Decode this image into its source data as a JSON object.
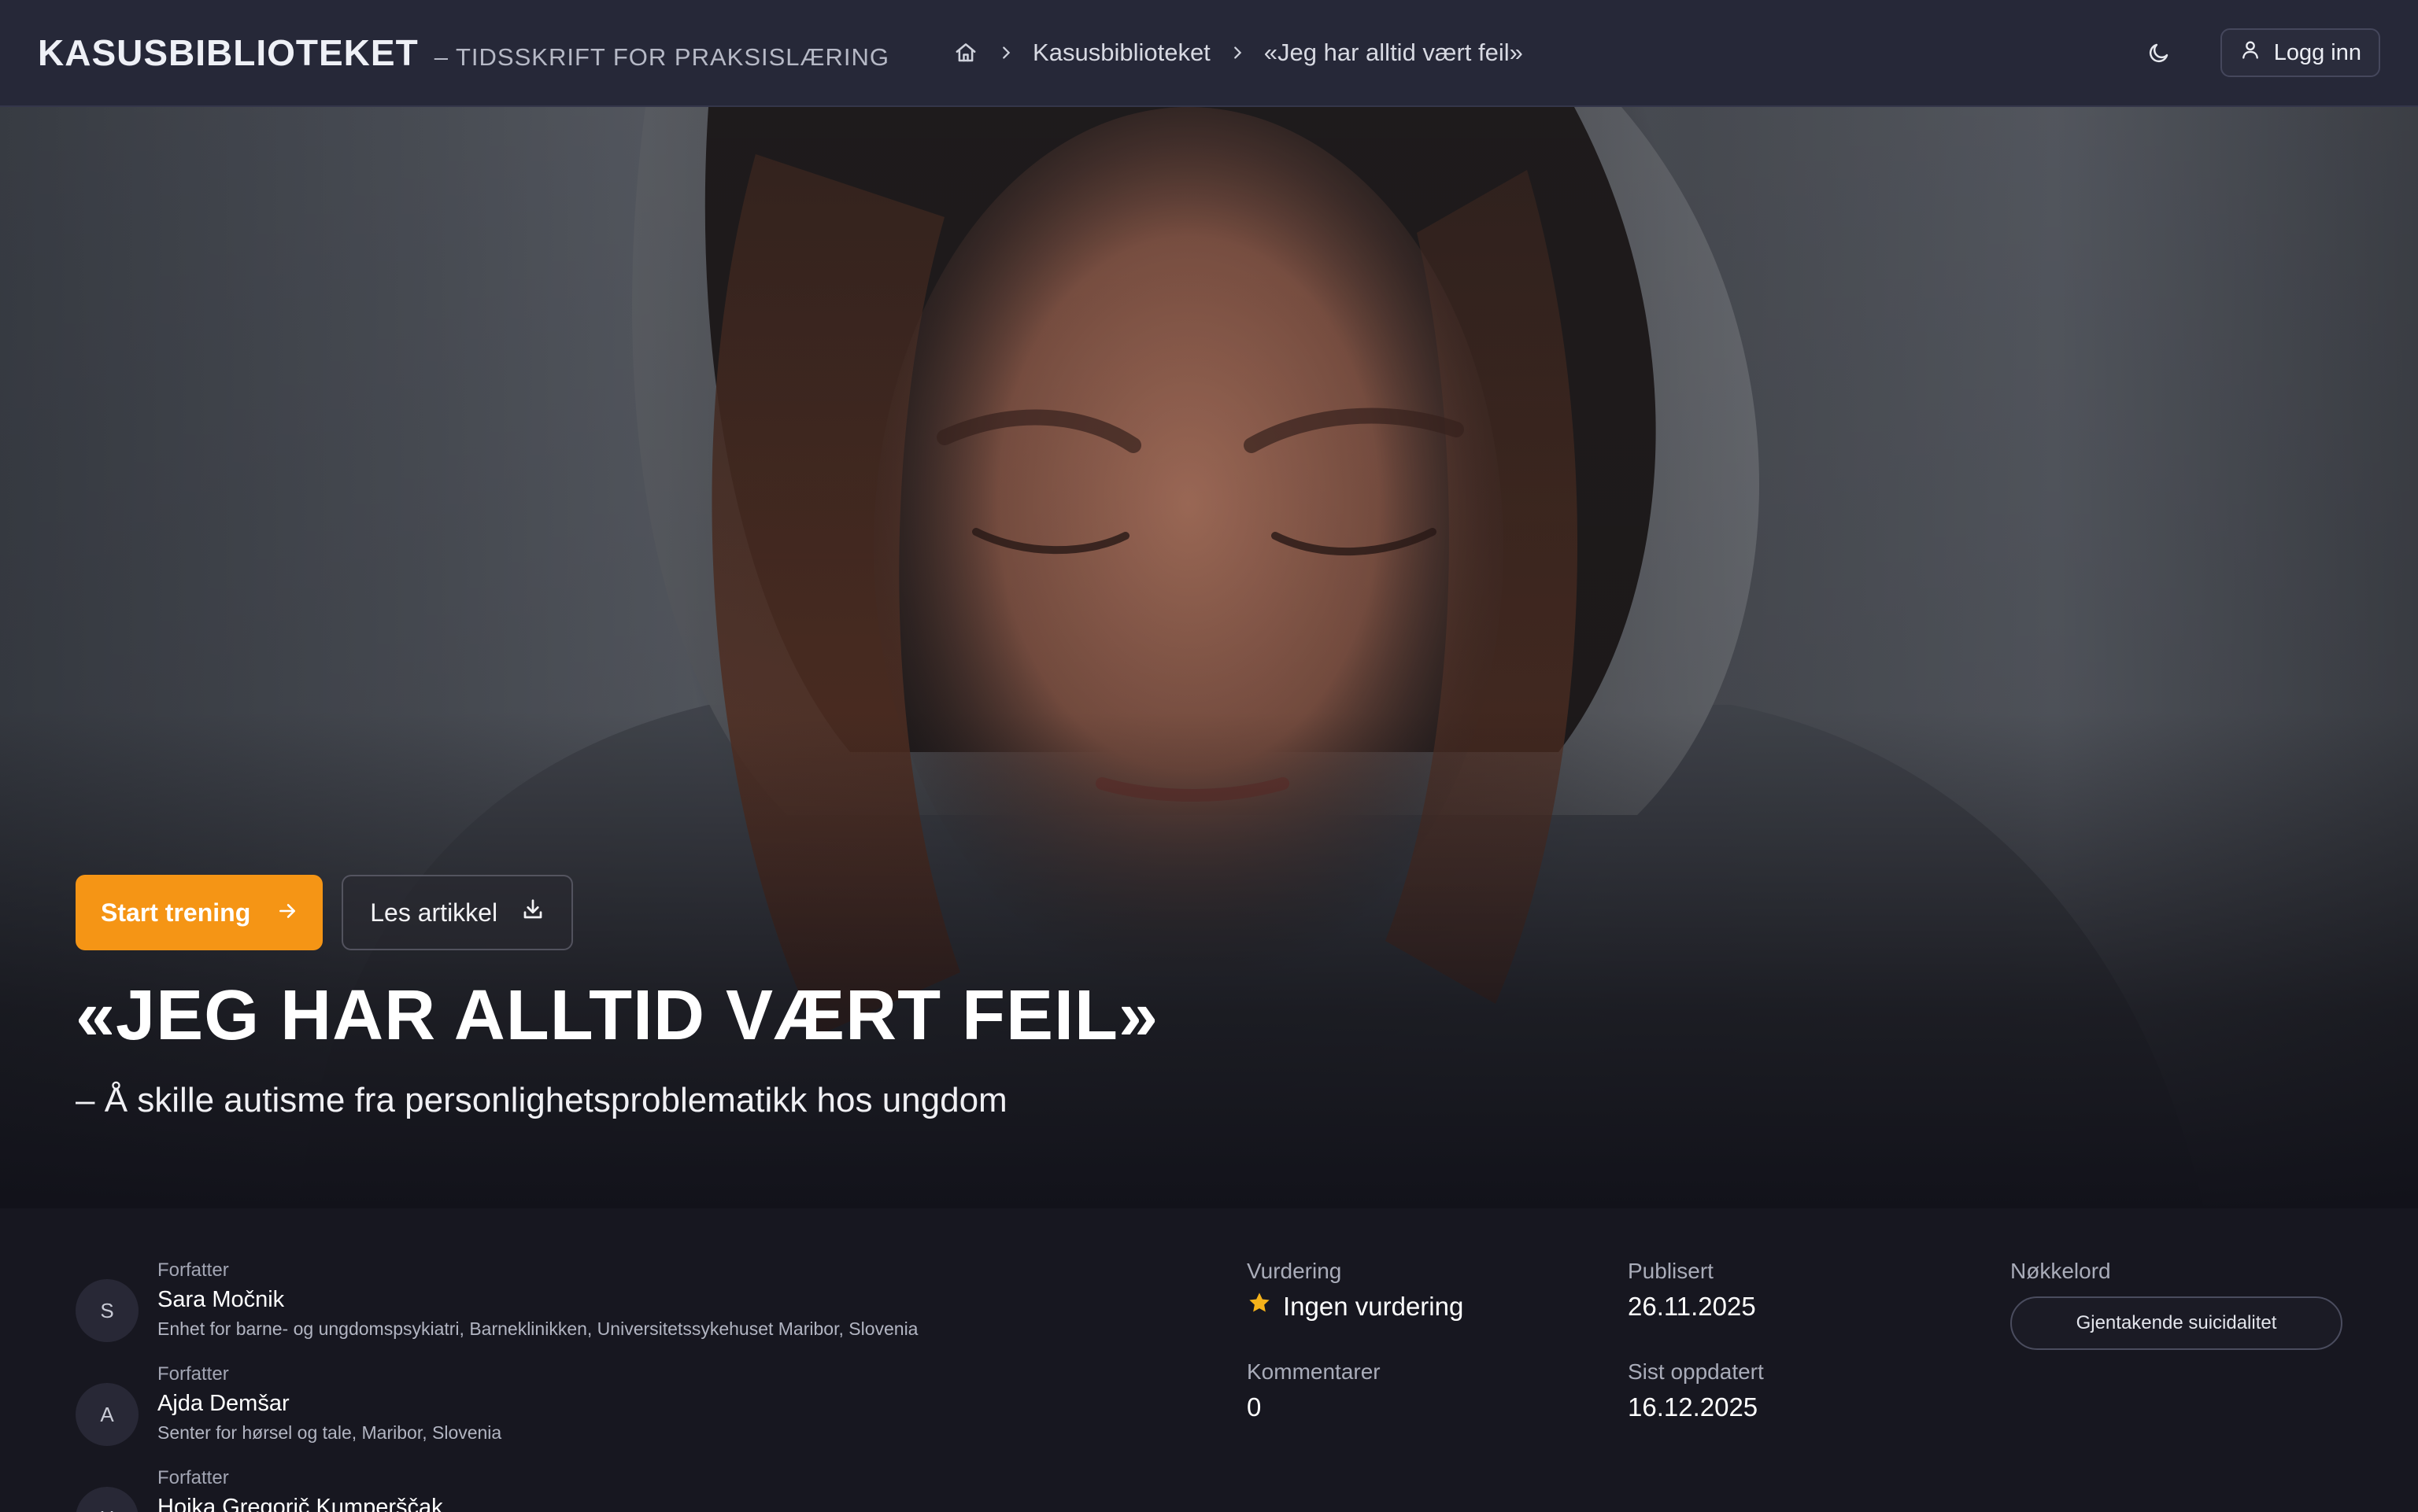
{
  "header": {
    "brand_title": "KASUSBIBLIOTEKET",
    "brand_subtitle": "– TIDSSKRIFT FOR PRAKSISLÆRING",
    "breadcrumb": {
      "home_icon": "home-icon",
      "items": [
        "Kasusbiblioteket",
        "«Jeg har alltid vært feil»"
      ]
    },
    "theme_toggle_icon": "moon-icon",
    "login": {
      "icon": "user-icon",
      "label": "Logg inn"
    }
  },
  "hero": {
    "image": "photo of young woman in grey hoodie looking down",
    "actions": {
      "start": {
        "label": "Start trening",
        "icon": "arrow-right-icon"
      },
      "read": {
        "label": "Les artikkel",
        "icon": "download-icon"
      }
    },
    "title": "«JEG HAR ALLTID VÆRT FEIL»",
    "subtitle": "– Å skille autisme fra personlighetsproblematikk hos ungdom"
  },
  "authors": [
    {
      "initial": "S",
      "role": "Forfatter",
      "name": "Sara Močnik",
      "affiliation": "Enhet for barne- og ungdomspsykiatri, Barneklinikken, Universitetssykehuset Maribor, Slovenia"
    },
    {
      "initial": "A",
      "role": "Forfatter",
      "name": "Ajda Demšar",
      "affiliation": "Senter for hørsel og tale, Maribor, Slovenia"
    },
    {
      "initial": "H",
      "role": "Forfatter",
      "name": "Hojka Gregorič Kumperščak",
      "affiliation": ""
    }
  ],
  "meta": {
    "rating": {
      "label": "Vurdering",
      "value": "Ingen vurdering",
      "icon": "star-icon"
    },
    "comments": {
      "label": "Kommentarer",
      "value": "0"
    },
    "published": {
      "label": "Publisert",
      "value": "26.11.2025"
    },
    "updated": {
      "label": "Sist oppdatert",
      "value": "16.12.2025"
    },
    "keywords": {
      "label": "Nøkkelord",
      "items": [
        "Gjentakende suicidalitet"
      ]
    }
  },
  "colors": {
    "accent": "#f59515",
    "header_bg": "#262838",
    "page_bg": "#171720",
    "star": "#f5b21a"
  }
}
